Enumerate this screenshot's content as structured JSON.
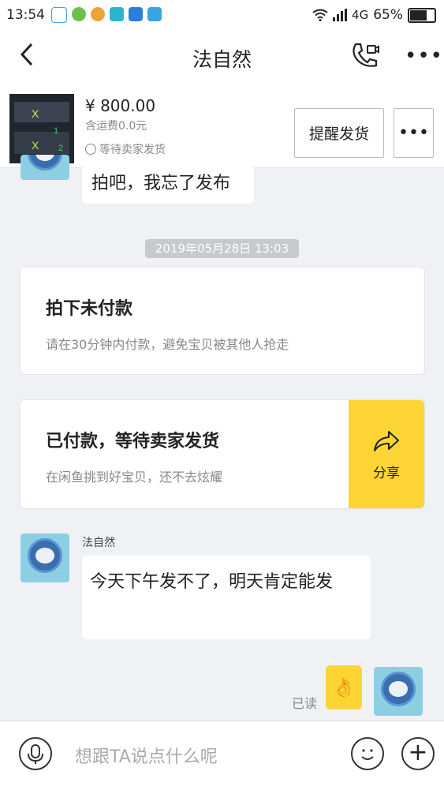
{
  "status_bar": {
    "time": "13:54",
    "network": "4G",
    "battery": "65%",
    "battery_level": 0.65
  },
  "header": {
    "title": "法自然"
  },
  "order": {
    "price": "¥ 800.00",
    "shipping": "含运费0.0元",
    "status": "等待卖家发货",
    "remind_button": "提醒发货"
  },
  "messages": {
    "prev_text": "拍吧，我忘了发布",
    "timestamp": "2019年05月28日 13:03",
    "card1": {
      "title": "拍下未付款",
      "desc": "请在30分钟内付款，避免宝贝被其他人抢走"
    },
    "card2": {
      "title": "已付款，等待卖家发货",
      "desc": "在闲鱼挑到好宝贝，还不去炫耀",
      "share": "分享"
    },
    "sender_name": "法自然",
    "seller_text": "今天下午发不了，明天肯定能发",
    "read_status": "已读",
    "sticker": "👌"
  },
  "input": {
    "placeholder": "想跟TA说点什么呢"
  },
  "colors": {
    "accent": "#fcd535",
    "background": "#f0f1f5"
  }
}
